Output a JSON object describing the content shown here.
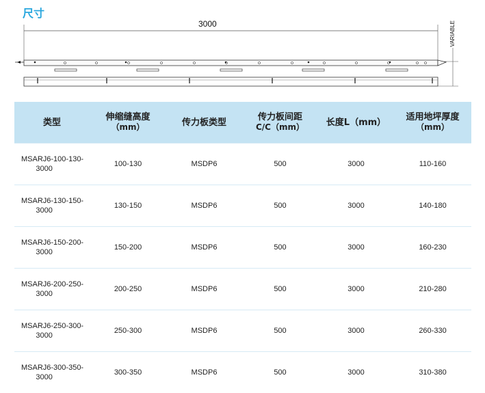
{
  "section_title": "尺寸",
  "drawing": {
    "length_label": "3000",
    "height_label": "VARIABLE"
  },
  "table": {
    "headers": [
      {
        "line1": "类型",
        "line2": ""
      },
      {
        "line1": "伸缩缝高度",
        "line2": "（mm）"
      },
      {
        "line1": "传力板类型",
        "line2": ""
      },
      {
        "line1": "传力板间距",
        "line2": "C/C（mm）"
      },
      {
        "line1": "长度L（mm）",
        "line2": ""
      },
      {
        "line1": "适用地坪厚度",
        "line2": "（mm）"
      }
    ],
    "rows": [
      {
        "type_a": "MSARJ6-100-130-",
        "type_b": "3000",
        "height": "100-130",
        "plate": "MSDP6",
        "spacing": "500",
        "length": "3000",
        "floor": "110-160"
      },
      {
        "type_a": "MSARJ6-130-150-",
        "type_b": "3000",
        "height": "130-150",
        "plate": "MSDP6",
        "spacing": "500",
        "length": "3000",
        "floor": "140-180"
      },
      {
        "type_a": "MSARJ6-150-200-",
        "type_b": "3000",
        "height": "150-200",
        "plate": "MSDP6",
        "spacing": "500",
        "length": "3000",
        "floor": "160-230"
      },
      {
        "type_a": "MSARJ6-200-250-",
        "type_b": "3000",
        "height": "200-250",
        "plate": "MSDP6",
        "spacing": "500",
        "length": "3000",
        "floor": "210-280"
      },
      {
        "type_a": "MSARJ6-250-300-",
        "type_b": "3000",
        "height": "250-300",
        "plate": "MSDP6",
        "spacing": "500",
        "length": "3000",
        "floor": "260-330"
      },
      {
        "type_a": "MSARJ6-300-350-",
        "type_b": "3000",
        "height": "300-350",
        "plate": "MSDP6",
        "spacing": "500",
        "length": "3000",
        "floor": "310-380"
      }
    ]
  }
}
